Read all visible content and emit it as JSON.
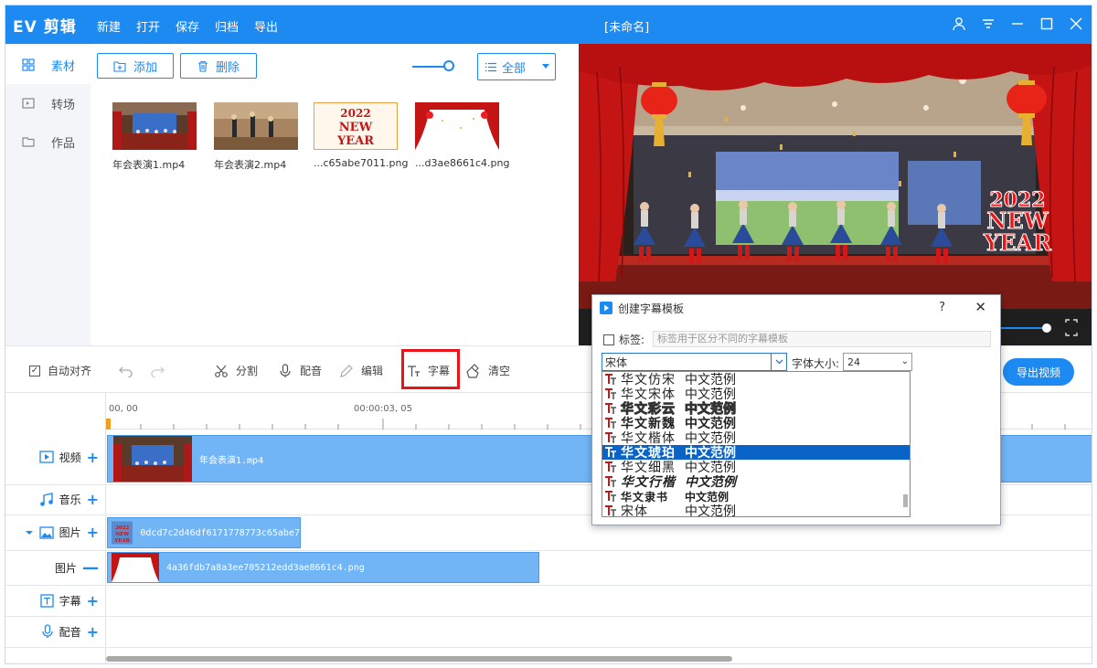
{
  "app": {
    "logo": "EV 剪辑",
    "menu": [
      "新建",
      "打开",
      "保存",
      "归档",
      "导出"
    ],
    "doc_title": "[未命名]"
  },
  "sidebar": {
    "items": [
      {
        "label": "素材",
        "icon": "grid-icon",
        "active": true
      },
      {
        "label": "转场",
        "icon": "transition-icon",
        "active": false
      },
      {
        "label": "作品",
        "icon": "folder-icon",
        "active": false
      }
    ]
  },
  "media": {
    "add_label": "添加",
    "delete_label": "删除",
    "filter_label": "全部",
    "files": [
      {
        "name": "年会表演1.mp4",
        "kind": "video-stage"
      },
      {
        "name": "年会表演2.mp4",
        "kind": "video-dance"
      },
      {
        "name": "...c65abe7011.png",
        "kind": "png-newyear"
      },
      {
        "name": "...d3ae8661c4.png",
        "kind": "png-curtain"
      }
    ]
  },
  "preview": {
    "year_text": "2022",
    "line2": "NEW",
    "line3": "YEAR"
  },
  "toolbar": {
    "auto_align": "自动对齐",
    "split": "分割",
    "dub": "配音",
    "edit": "编辑",
    "subtitle": "字幕",
    "clear": "清空",
    "export": "导出视频"
  },
  "timeline": {
    "time_start": "00, 00",
    "time_mid": "00:00:03, 05",
    "tracks": [
      {
        "label": "视频",
        "icon": "video-icon",
        "control": "+"
      },
      {
        "label": "音乐",
        "icon": "music-icon",
        "control": "+"
      },
      {
        "label": "图片",
        "icon": "image-icon",
        "control": "+"
      },
      {
        "label": "图片",
        "icon": "",
        "control": "—"
      },
      {
        "label": "字幕",
        "icon": "text-icon",
        "control": "+"
      },
      {
        "label": "配音",
        "icon": "mic-icon",
        "control": "+"
      }
    ],
    "clips": {
      "video": "年会表演1.mp4",
      "image1": "0dcd7c2d46df6171778773c65abe7",
      "image2": "4a36fdb7a8a3ee705212edd3ae8661c4.png"
    }
  },
  "dialog": {
    "title": "创建字幕模板",
    "help": "?",
    "close": "✕",
    "tag_label": "标签:",
    "tag_placeholder": "标签用于区分不同的字幕模板",
    "font_value": "宋体",
    "size_label": "字体大小:",
    "size_value": "24",
    "fonts": [
      {
        "name": "华文仿宋",
        "sample": "中文范例",
        "selected": false
      },
      {
        "name": "华文宋体",
        "sample": "中文范例",
        "selected": false
      },
      {
        "name": "华文彩云",
        "sample": "中文范例",
        "selected": false
      },
      {
        "name": "华文新魏",
        "sample": "中文范例",
        "selected": false
      },
      {
        "name": "华文楷体",
        "sample": "中文范例",
        "selected": false
      },
      {
        "name": "华文琥珀",
        "sample": "中文范例",
        "selected": true
      },
      {
        "name": "华文细黑",
        "sample": "中文范例",
        "selected": false
      },
      {
        "name": "华文行楷",
        "sample": "中文范例",
        "selected": false
      },
      {
        "name": "华文隶书",
        "sample": "中文范例",
        "selected": false
      },
      {
        "name": "宋体",
        "sample": "中文范例",
        "selected": false
      }
    ]
  },
  "colors": {
    "accent": "#1c8af0",
    "highlight": "#e8141a",
    "clip": "#72b5f7",
    "selection": "#0a64c8"
  }
}
